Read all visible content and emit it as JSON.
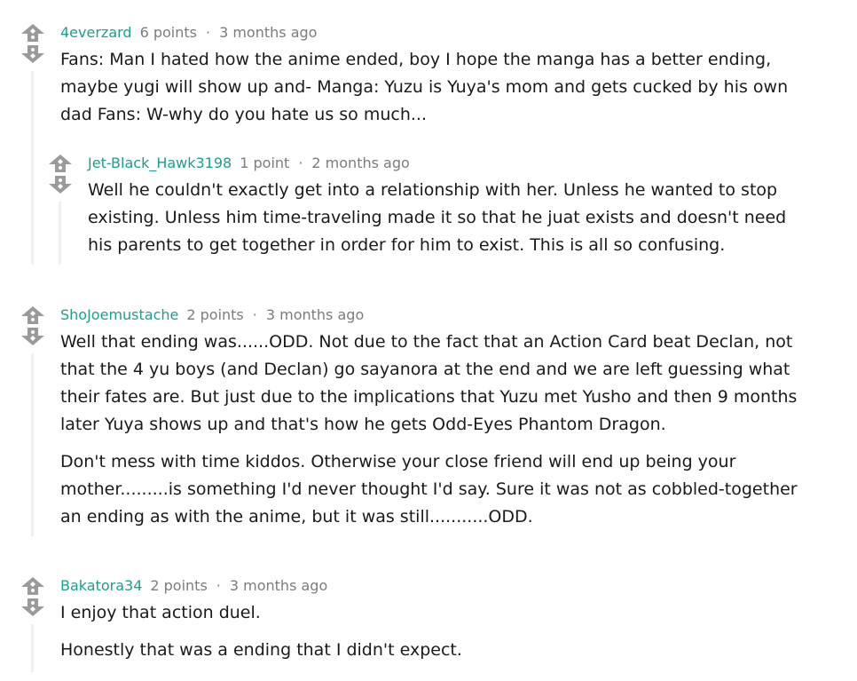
{
  "colors": {
    "author": "#1e9e8c",
    "meta": "#7c7c7c",
    "text": "#1a1a1b",
    "rail": "#edeff1",
    "vote_icon": "#9a9a9a"
  },
  "icons": {
    "upvote": "upvote-icon",
    "downvote": "downvote-icon"
  },
  "comments": [
    {
      "author": "4everzard",
      "points": "6 points",
      "separator": "·",
      "time": "3 months ago",
      "paragraphs": [
        "Fans: Man I hated how the anime ended, boy I hope the manga has a better ending, maybe yugi will show up and- Manga: Yuzu is Yuya's mom and gets cucked by his own dad Fans: W-why do you hate us so much..."
      ]
    },
    {
      "author": "Jet-Black_Hawk3198",
      "points": "1 point",
      "separator": "·",
      "time": "2 months ago",
      "paragraphs": [
        "Well he couldn't exactly get into a relationship with her. Unless he wanted to stop existing. Unless him time-traveling made it so that he juat exists and doesn't need his parents to get together in order for him to exist. This is all so confusing."
      ]
    },
    {
      "author": "ShoJoemustache",
      "points": "2 points",
      "separator": "·",
      "time": "3 months ago",
      "paragraphs": [
        "Well that ending was......ODD. Not due to the fact that an Action Card beat Declan, not that the 4 yu boys (and Declan) go sayanora at the end and we are left guessing what their fates are. But just due to the implications that Yuzu met Yusho and then 9 months later Yuya shows up and that's how he gets Odd-Eyes Phantom Dragon.",
        "Don't mess with time kiddos. Otherwise your close friend will end up being your mother.........is something I'd never thought I'd say. Sure it was not as cobbled-together an ending as with the anime, but it was still...........ODD."
      ]
    },
    {
      "author": "Bakatora34",
      "points": "2 points",
      "separator": "·",
      "time": "3 months ago",
      "paragraphs": [
        "I enjoy that action duel.",
        "Honestly that was a ending that I didn't expect."
      ]
    }
  ]
}
